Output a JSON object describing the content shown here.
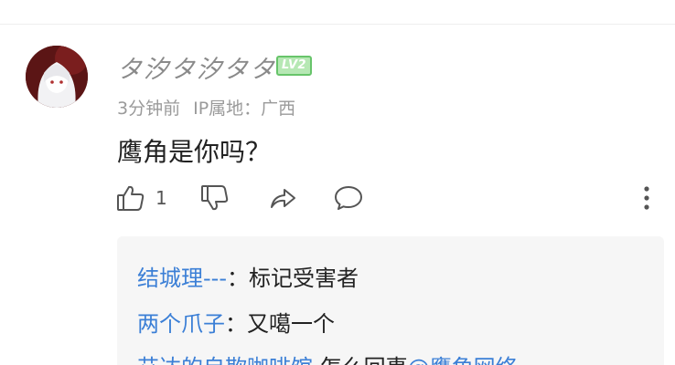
{
  "comment": {
    "username": "タ汐タ汐タタ",
    "level": "LV2",
    "time": "3分钟前",
    "ip": "IP属地：广西",
    "text": "鹰角是你吗？",
    "like_count": "1"
  },
  "icons": {
    "like": "thumbs-up-icon",
    "dislike": "thumbs-down-icon",
    "share": "share-icon",
    "reply": "comment-bubble-icon",
    "more": "more-vertical-icon"
  },
  "replies": [
    {
      "author": "结城理---",
      "sep": "：",
      "text": "标记受害者",
      "mention": ""
    },
    {
      "author": "两个爪子",
      "sep": "：",
      "text": "又噶一个",
      "mention": ""
    },
    {
      "author": "艾达的自欺咖啡馆",
      "sep": "",
      "text": "怎么回事",
      "mention": "@鹰角网络"
    }
  ],
  "colors": {
    "link_blue": "#3b7fd6",
    "level_green": "#67c46a",
    "meta_gray": "#9a9a9a",
    "reply_bg": "#f6f6f6"
  }
}
